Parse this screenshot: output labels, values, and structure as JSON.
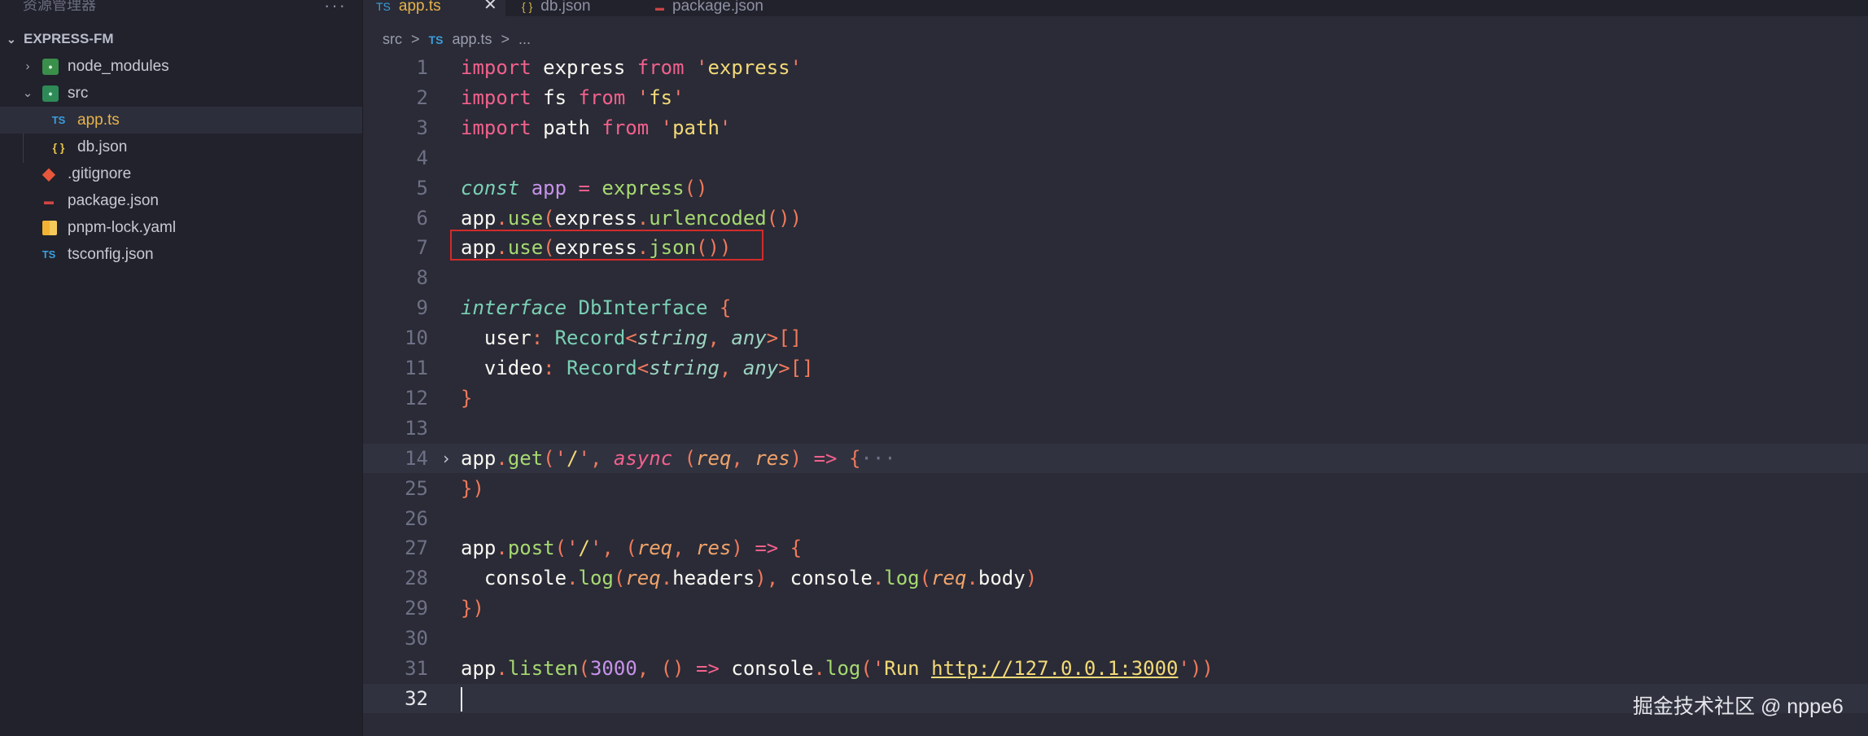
{
  "sidebar": {
    "header": "资源管理器",
    "more": "···",
    "project": "EXPRESS-FM",
    "items": [
      {
        "label": "node_modules",
        "icon": "node-modules-folder-icon"
      },
      {
        "label": "src",
        "icon": "src-folder-icon"
      },
      {
        "label": "app.ts",
        "icon": "typescript-icon",
        "badge": "TS"
      },
      {
        "label": "db.json",
        "icon": "json-icon",
        "badge": "{ }"
      },
      {
        "label": ".gitignore",
        "icon": "git-icon"
      },
      {
        "label": "package.json",
        "icon": "npm-icon"
      },
      {
        "label": "pnpm-lock.yaml",
        "icon": "pnpm-icon"
      },
      {
        "label": "tsconfig.json",
        "icon": "tsconfig-icon",
        "badge": "TS"
      }
    ]
  },
  "tabs": [
    {
      "label": "app.ts",
      "badge": "TS",
      "active": true,
      "close": "✕"
    },
    {
      "label": "db.json",
      "badge": "{ }",
      "active": false
    },
    {
      "label": "package.json",
      "badge": "npm",
      "active": false
    }
  ],
  "breadcrumb": {
    "src": "src",
    "sep": ">",
    "ts": "TS",
    "file": "app.ts",
    "more": "..."
  },
  "code": {
    "lines": [
      {
        "n": "1",
        "text": "import express from 'express'"
      },
      {
        "n": "2",
        "text": "import fs from 'fs'"
      },
      {
        "n": "3",
        "text": "import path from 'path'"
      },
      {
        "n": "4",
        "text": ""
      },
      {
        "n": "5",
        "text": "const app = express()"
      },
      {
        "n": "6",
        "text": "app.use(express.urlencoded())"
      },
      {
        "n": "7",
        "text": "app.use(express.json())"
      },
      {
        "n": "8",
        "text": ""
      },
      {
        "n": "9",
        "text": "interface DbInterface {"
      },
      {
        "n": "10",
        "text": "  user: Record<string, any>[]"
      },
      {
        "n": "11",
        "text": "  video: Record<string, any>[]"
      },
      {
        "n": "12",
        "text": "}"
      },
      {
        "n": "13",
        "text": ""
      },
      {
        "n": "14",
        "text": "app.get('/', async (req, res) => {···"
      },
      {
        "n": "25",
        "text": "})"
      },
      {
        "n": "26",
        "text": ""
      },
      {
        "n": "27",
        "text": "app.post('/', (req, res) => {"
      },
      {
        "n": "28",
        "text": "  console.log(req.headers), console.log(req.body)"
      },
      {
        "n": "29",
        "text": "})"
      },
      {
        "n": "30",
        "text": ""
      },
      {
        "n": "31",
        "text": "app.listen(3000, () => console.log('Run http://127.0.0.1:3000'))"
      },
      {
        "n": "32",
        "text": ""
      }
    ]
  },
  "watermark": "掘金技术社区 @ nppe6",
  "colors": {
    "accent": "#e6b34c",
    "highlight_box": "#d22b2b",
    "background": "#2a2b36",
    "sidebar": "#21222c"
  }
}
